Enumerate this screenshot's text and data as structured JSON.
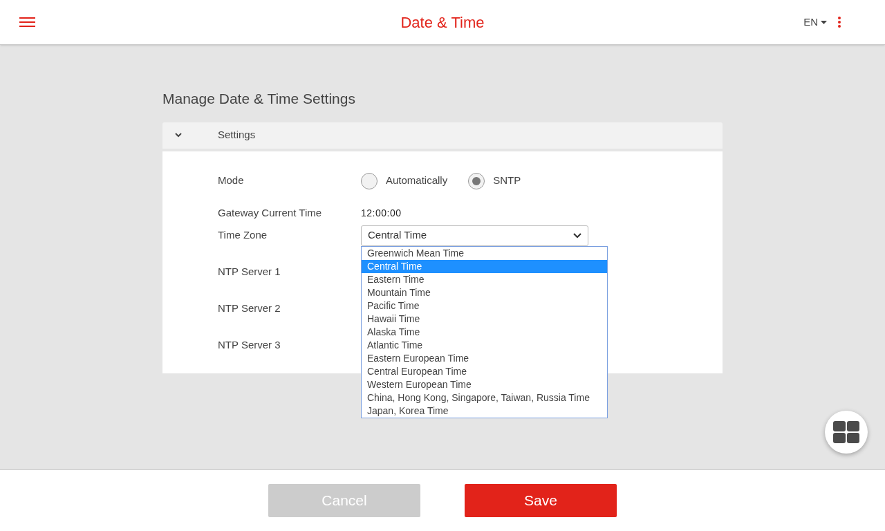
{
  "header": {
    "title": "Date & Time",
    "language": "EN"
  },
  "page_title": "Manage Date & Time Settings",
  "section": {
    "title": "Settings",
    "expanded": true
  },
  "mode": {
    "label": "Mode",
    "options": [
      {
        "label": "Automatically",
        "selected": false
      },
      {
        "label": "SNTP",
        "selected": true
      }
    ]
  },
  "current_time": {
    "label": "Gateway Current Time",
    "value": "12:00:00"
  },
  "time_zone": {
    "label": "Time Zone",
    "value": "Central Time",
    "expanded": true,
    "options": [
      {
        "label": "Greenwich Mean Time",
        "selected": false
      },
      {
        "label": "Central Time",
        "selected": true
      },
      {
        "label": "Eastern Time",
        "selected": false
      },
      {
        "label": "Mountain Time",
        "selected": false
      },
      {
        "label": "Pacific Time",
        "selected": false
      },
      {
        "label": "Hawaii Time",
        "selected": false
      },
      {
        "label": "Alaska Time",
        "selected": false
      },
      {
        "label": "Atlantic Time",
        "selected": false
      },
      {
        "label": "Eastern European Time",
        "selected": false
      },
      {
        "label": "Central European Time",
        "selected": false
      },
      {
        "label": "Western European Time",
        "selected": false
      },
      {
        "label": "China, Hong Kong, Singapore, Taiwan, Russia Time",
        "selected": false
      },
      {
        "label": "Japan, Korea Time",
        "selected": false
      }
    ]
  },
  "ntp_servers": [
    "NTP Server 1",
    "NTP Server 2",
    "NTP Server 3"
  ],
  "buttons": [
    {
      "label": "Cancel",
      "disabled": true
    },
    {
      "label": "Save",
      "disabled": false
    }
  ]
}
